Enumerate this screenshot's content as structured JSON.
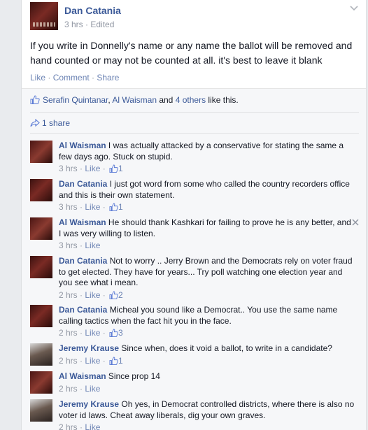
{
  "post": {
    "author": "Dan Catania",
    "time": "3 hrs",
    "edited": "Edited",
    "text": "If you write in Donnelly's name or any name the ballot will be removed and hand counted or may not be counted at all. it's best to leave it blank",
    "actions": {
      "like": "Like",
      "comment": "Comment",
      "share": "Share"
    }
  },
  "likes": {
    "name1": "Serafin Quintanar",
    "name2": "Al Waisman",
    "and": " and ",
    "others": "4 others",
    "suffix": " like this."
  },
  "shares": {
    "label": "1 share"
  },
  "colors": {
    "link": "#3b5998",
    "meta": "#9197a3",
    "action": "#6d84b4"
  },
  "comments": [
    {
      "author": "Al Waisman",
      "text": "I was actually attacked by a conservative for stating the same a few days ago. Stuck on stupid.",
      "time": "3 hrs",
      "like": "Like",
      "likes": "1"
    },
    {
      "author": "Dan Catania",
      "text": "I just got word from some who called the country recorders office and this is their own statement.",
      "time": "3 hrs",
      "like": "Like",
      "likes": "1"
    },
    {
      "author": "Al Waisman",
      "text": "He should thank Kashkari for failing to prove he is any better, and I was very willing to listen.",
      "time": "3 hrs",
      "like": "Like",
      "likes": ""
    },
    {
      "author": "Dan Catania",
      "text": "Not to worry .. Jerry Brown and the Democrats rely on voter fraud to get elected. They have for years... Try poll watching one election year and you see what i mean.",
      "time": "2 hrs",
      "like": "Like",
      "likes": "2"
    },
    {
      "author": "Dan Catania",
      "text": "Micheal you sound like a Democrat.. You use the same name calling tactics when the fact hit you in the face.",
      "time": "2 hrs",
      "like": "Like",
      "likes": "3"
    },
    {
      "author": "Jeremy Krause",
      "text": "Since when, does it void a ballot, to write in a candidate?",
      "time": "2 hrs",
      "like": "Like",
      "likes": "1"
    },
    {
      "author": "Al Waisman",
      "text": "Since prop 14",
      "time": "2 hrs",
      "like": "Like",
      "likes": ""
    },
    {
      "author": "Jeremy Krause",
      "text": "Oh yes, in Democrat controlled districts, where there is also no voter id laws. Cheat away liberals, dig your own graves.",
      "time": "2 hrs",
      "like": "Like",
      "likes": ""
    }
  ]
}
